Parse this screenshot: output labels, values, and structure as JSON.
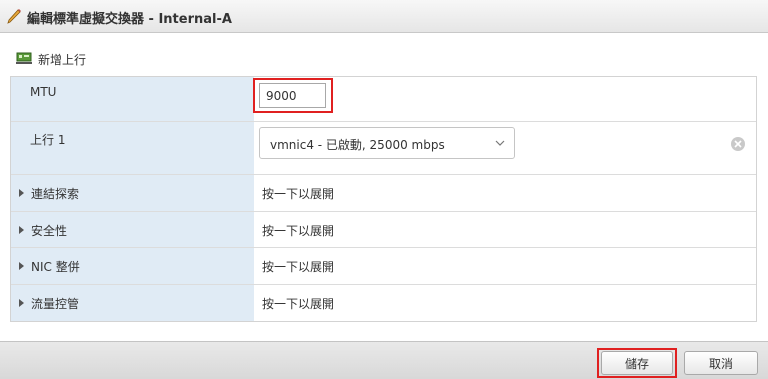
{
  "dialog": {
    "title": "編輯標準虛擬交換器 - Internal-A"
  },
  "toolbar": {
    "add_uplink_label": "新增上行"
  },
  "rows": {
    "mtu": {
      "label": "MTU",
      "value": "9000"
    },
    "uplink1": {
      "label": "上行 1",
      "selected": "vmnic4 - 已啟動, 25000 mbps"
    },
    "link_discovery": {
      "label": "連結探索",
      "value": "按一下以展開"
    },
    "security": {
      "label": "安全性",
      "value": "按一下以展開"
    },
    "nic_teaming": {
      "label": "NIC 整併",
      "value": "按一下以展開"
    },
    "traffic_shaping": {
      "label": "流量控管",
      "value": "按一下以展開"
    }
  },
  "footer": {
    "save_label": "儲存",
    "cancel_label": "取消"
  },
  "colors": {
    "label_bg": "#e0ebf5",
    "highlight": "#e02020",
    "footer_bg": "#dddddd"
  },
  "icons": {
    "title": "pencil-icon",
    "add_uplink": "network-card-icon",
    "expand": "triangle-right-icon",
    "dropdown": "chevron-down-icon",
    "clear": "clear-icon"
  }
}
